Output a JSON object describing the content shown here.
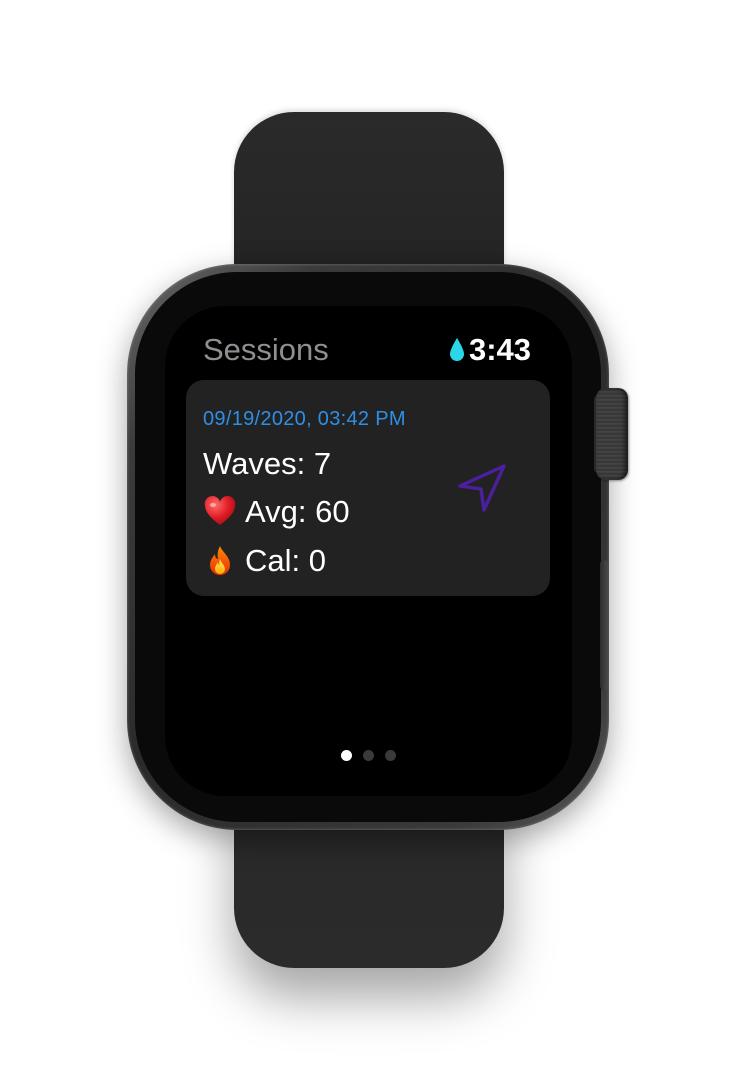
{
  "header": {
    "title": "Sessions",
    "time": "3:43"
  },
  "session": {
    "date": "09/19/2020, 03:42 PM",
    "waves": "Waves: 7",
    "avg": "Avg: 60",
    "cal": "Cal: 0"
  },
  "icons": {
    "status": "water-drop-icon",
    "heart": "heart-icon",
    "fire": "fire-icon",
    "navigation": "location-arrow-icon"
  },
  "colors": {
    "date_accent": "#2f8fe6",
    "nav_icon": "#4b1fa0",
    "drop": "#2bd6e8",
    "card_bg": "#222222"
  },
  "pagination": {
    "pages": 3,
    "current": 1
  }
}
